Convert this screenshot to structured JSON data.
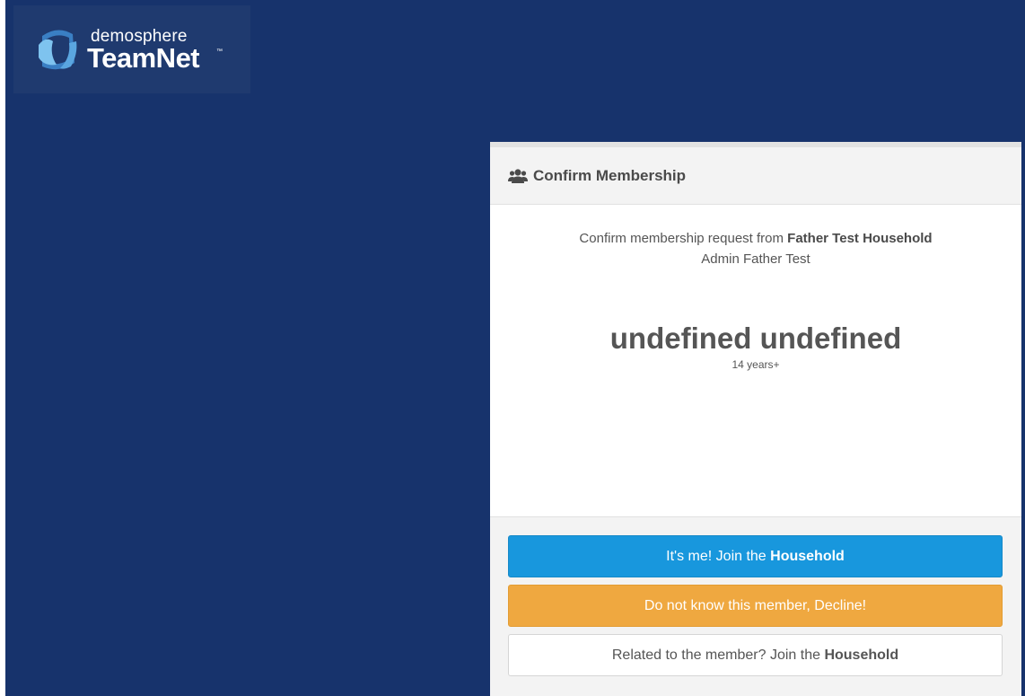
{
  "brand": {
    "line1": "demosphere",
    "line2": "TeamNet",
    "tm": "™"
  },
  "panel": {
    "title": "Confirm Membership",
    "icon": "users-icon",
    "request_prefix": "Confirm membership request from",
    "household_name": "Father Test Household",
    "admin_line": "Admin Father Test",
    "member_name": "undefined undefined",
    "member_age": "14 years+"
  },
  "actions": {
    "join_prefix": "It's me! Join the",
    "join_strong": "Household",
    "decline": "Do not know this member, Decline!",
    "related_prefix": "Related to the member? Join the",
    "related_strong": "Household"
  },
  "colors": {
    "background": "#17336c",
    "primary": "#1897dd",
    "warning": "#efa840"
  }
}
